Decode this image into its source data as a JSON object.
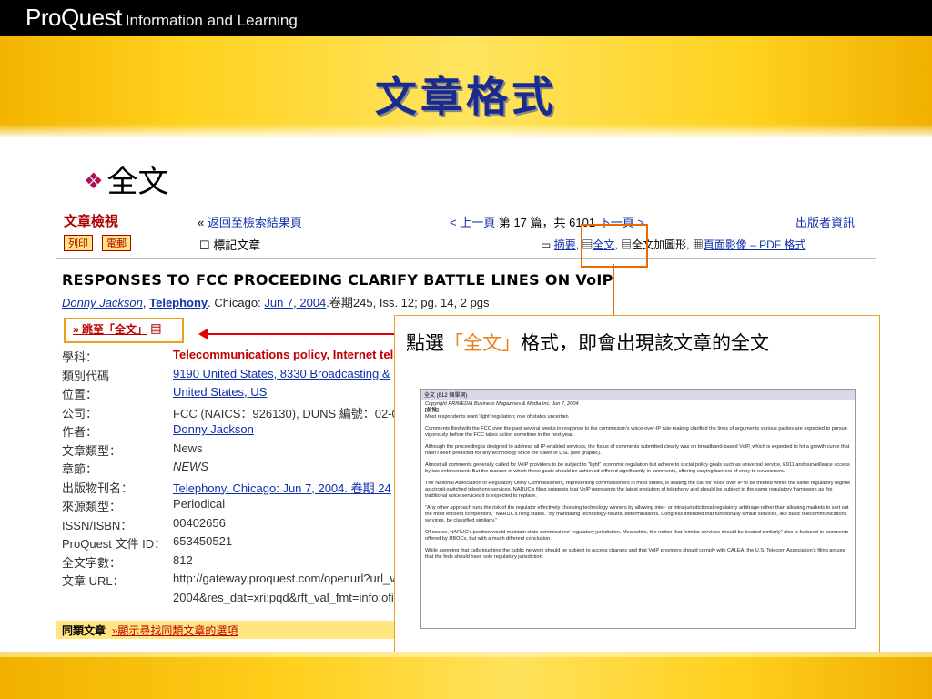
{
  "header": {
    "brand": "ProQuest",
    "tagline": "Information and Learning"
  },
  "slide": {
    "title": "文章格式",
    "bullet_icon": "diamond-bullet-icon",
    "bullet": "全文"
  },
  "shot": {
    "title": "文章檢視",
    "back": "返回至檢索結果頁",
    "prev": "< 上一頁",
    "position": "第 17 篇，共 6101",
    "next": "下一頁 >",
    "publisher": "出版者資訊",
    "print": "列印",
    "email": "電郵",
    "mark": "標記文章",
    "formats": {
      "abstract": "摘要",
      "fulltext": "全文",
      "fulltext_graphics": "全文加圖形",
      "page_image": "頁面影像 – PDF 格式"
    },
    "headline": "RESPONSES TO FCC PROCEEDING CLARIFY BATTLE LINES ON VoIP",
    "author": "Donny Jackson",
    "publication": "Telephony",
    "place": "Chicago:",
    "date": "Jun 7, 2004",
    "issue": "卷期245, Iss. 12;  pg. 14, 2 pgs",
    "jump": "» 跳至「全文」",
    "fields": [
      {
        "label": "學科：",
        "value": "Telecommunications policy,  Internet tel"
      },
      {
        "label": "類別代碼",
        "value": "9190 United States,  8330 Broadcasting &"
      },
      {
        "label": "位置：",
        "value": "United States,  US"
      },
      {
        "label": "公司：",
        "value": "FCC (NAICS：926130), DUNS 編號：02-0"
      },
      {
        "label": "作者：",
        "value": "Donny Jackson"
      },
      {
        "label": "文章類型：",
        "value": "News"
      },
      {
        "label": "章節：",
        "value": "NEWS"
      },
      {
        "label": "出版物刊名：",
        "value": "Telephony. Chicago: Jun 7, 2004. 卷期 24"
      },
      {
        "label": "來源類型：",
        "value": "Periodical"
      },
      {
        "label": "ISSN/ISBN：",
        "value": "00402656"
      },
      {
        "label": "ProQuest 文件 ID：",
        "value": "653450521"
      },
      {
        "label": "全文字數：",
        "value": "812"
      },
      {
        "label": "文章 URL：",
        "value": "http://gateway.proquest.com/openurl?url_v"
      },
      {
        "label": "",
        "value": "2004&res_dat=xri:pqd&rft_val_fmt=info:ofi"
      }
    ],
    "similar_label": "同類文章",
    "similar_link": "»顯示尋找同類文章的選項"
  },
  "callout": {
    "pre": "點選",
    "highlight": "「全文」",
    "post": "格式，即會出現該文章的全文"
  },
  "fulltext": {
    "header": "全文 (812  個單詞)",
    "copyright": "Copyright PRIMEDIA Business Magazines & Media Inc. Jun 7, 2004",
    "tag": "[前批]",
    "lead": "Most respondents want 'light' regulation; role of states uncertain",
    "paragraphs": [
      "Comments filed with the FCC over the past several weeks in response to the commission's voice-over-IP rule-making clarified the lines of arguments various parties are expected to pursue vigorously before the FCC takes action sometime in the next year.",
      "Although the proceeding is designed to address all IP-enabled services, the focus of comments submitted clearly was on broadband-based VoIP, which is expected to hit a growth curve that hasn't been predicted for any technology since the dawn of DSL (see graphic).",
      "Almost all comments generally called for VoIP providers to be subject to \"light\" economic regulation but adhere to social policy goals such as universal service, E911 and surveillance access by law enforcement. But the manner in which these goals should be achieved differed significantly in comments, offering varying barriers of entry to newcomers.",
      "The National Association of Regulatory Utility Commissioners, representing commissioners in most states, is leading the call for voice over IP to be treated within the same regulatory regime as circuit-switched telephony services. NARUC's filing suggests that VoIP represents the latest evolution of telephony and should be subject to the same regulatory framework as the traditional voice services it is expected to replace.",
      "\"Any other approach runs the risk of the regulator effectively choosing technology winners by allowing inter- or intra-jurisdictional regulatory arbitrage-rather than allowing markets to sort out the most efficient competitors,\" NARUC's filing states. \"By mandating technology-neutral determinations, Congress intended that functionally similar services, like basic telecommunications services, be classified similarly.\"",
      "Of course, NARUC's position would maintain state commissions' regulatory jurisdiction. Meanwhile, the notion that \"similar services should be treated similarly\" also is featured in comments offered by RBOCs, but with a much different conclusion.",
      "While agreeing that calls touching the public network should be subject to access charges and that VoIP providers should comply with CALEA, the U.S. Telecom Association's filing argues that the feds should have sole regulatory jurisdiction."
    ]
  },
  "colors": {
    "title": "#1a2b8f",
    "accent": "#e86a00",
    "banner": "#ffd21f",
    "link": "#1030a8",
    "label_red": "#b00000"
  }
}
